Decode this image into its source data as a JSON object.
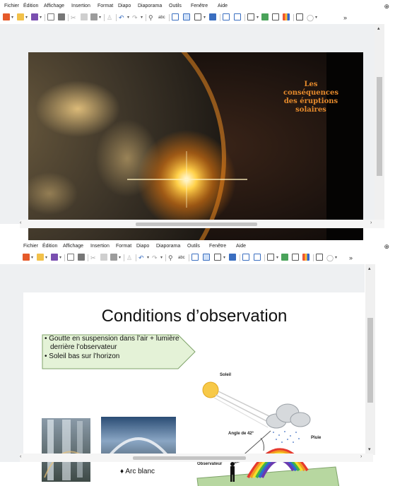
{
  "menu": [
    "Fichier",
    "Édition",
    "Affichage",
    "Insertion",
    "Format",
    "Diapo",
    "Diaporama",
    "Outils",
    "Fenêtre",
    "Aide"
  ],
  "toolbar": {
    "overflow": "»",
    "buttons": [
      "new-icon",
      "open-icon",
      "save-icon",
      "export-pdf-icon",
      "print-icon",
      "cut-icon",
      "copy-icon",
      "paste-icon",
      "clone-format-icon",
      "undo-icon",
      "redo-icon",
      "find-replace-icon",
      "spelling-icon",
      "grid-icon",
      "display-views-icon",
      "master-slide-icon",
      "slide-layout-icon",
      "start-first-icon",
      "start-current-icon",
      "table-icon",
      "image-icon",
      "textbox-icon",
      "chart-icon",
      "fontwork-icon",
      "shapes-icon"
    ]
  },
  "window1": {
    "slide": {
      "title_lines": [
        "Les",
        "conséquences",
        "des éruptions",
        "solaires"
      ]
    }
  },
  "window2": {
    "slide": {
      "title": "Conditions d’observation",
      "bullets": [
        "Goutte en suspension dans l’air + lumière",
        "derrière l’observateur",
        "Soleil bas sur l’horizon"
      ],
      "caption": "Arc blanc",
      "diagram_labels": {
        "sun": "Soleil",
        "angle": "Angle de 42°",
        "rain": "Pluie",
        "observer": "Observateur"
      }
    }
  },
  "colors": {
    "title_orange": "#e58a2c",
    "arrow_fill": "#e4f2d7",
    "ground": "#b7d7a0"
  }
}
